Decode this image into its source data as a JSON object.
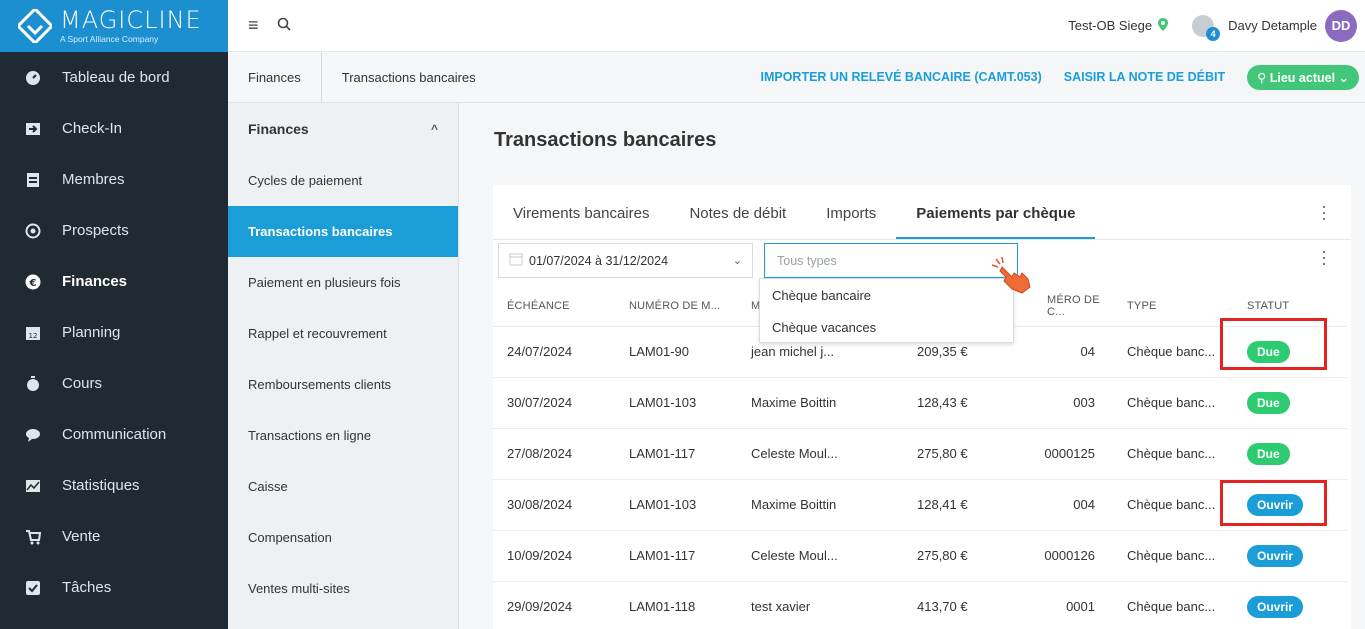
{
  "brand": {
    "name": "MAGICLINE",
    "sub": "A Sport Alliance Company"
  },
  "sidebar": {
    "items": [
      {
        "label": "Tableau de bord",
        "icon": "dashboard-icon"
      },
      {
        "label": "Check-In",
        "icon": "check-in-icon"
      },
      {
        "label": "Membres",
        "icon": "members-icon"
      },
      {
        "label": "Prospects",
        "icon": "prospects-icon"
      },
      {
        "label": "Finances",
        "icon": "euro-icon"
      },
      {
        "label": "Planning",
        "icon": "calendar-icon"
      },
      {
        "label": "Cours",
        "icon": "stopwatch-icon"
      },
      {
        "label": "Communication",
        "icon": "chat-icon"
      },
      {
        "label": "Statistiques",
        "icon": "chart-icon"
      },
      {
        "label": "Vente",
        "icon": "cart-icon"
      },
      {
        "label": "Tâches",
        "icon": "checkbox-icon"
      }
    ]
  },
  "topbar": {
    "location": "Test-OB Siege",
    "downloads": "4",
    "user": "Davy Detample",
    "initials": "DD"
  },
  "breadcrumb": {
    "first": "Finances",
    "current": "Transactions bancaires"
  },
  "actions": {
    "import": "IMPORTER UN RELEVÉ BANCAIRE (CAMT.053)",
    "debit": "SAISIR LA NOTE DE DÉBIT",
    "lieu": "Lieu actuel"
  },
  "submenu": {
    "title": "Finances",
    "items": [
      "Cycles de paiement",
      "Transactions bancaires",
      "Paiement en plusieurs fois",
      "Rappel et recouvrement",
      "Remboursements clients",
      "Transactions en ligne",
      "Caisse",
      "Compensation",
      "Ventes multi-sites"
    ]
  },
  "page": {
    "title": "Transactions bancaires"
  },
  "tabs": [
    "Virements bancaires",
    "Notes de débit",
    "Imports",
    "Paiements par chèque"
  ],
  "filters": {
    "date_range": "01/07/2024 à 31/12/2024",
    "type_placeholder": "Tous types"
  },
  "dropdown": {
    "options": [
      "Chèque bancaire",
      "Chèque vacances"
    ]
  },
  "table": {
    "headers": [
      "ÉCHÉANCE",
      "NUMÉRO DE M...",
      "M",
      "",
      "MÉRO DE C...",
      "TYPE",
      "STATUT"
    ],
    "rows": [
      {
        "date": "24/07/2024",
        "num": "LAM01-90",
        "member": "jean michel j...",
        "amount": "209,35 €",
        "cheque": "04",
        "type": "Chèque banc...",
        "status": "Due"
      },
      {
        "date": "30/07/2024",
        "num": "LAM01-103",
        "member": "Maxime Boittin",
        "amount": "128,43 €",
        "cheque": "003",
        "type": "Chèque banc...",
        "status": "Due"
      },
      {
        "date": "27/08/2024",
        "num": "LAM01-117",
        "member": "Celeste Moul...",
        "amount": "275,80 €",
        "cheque": "0000125",
        "type": "Chèque banc...",
        "status": "Due"
      },
      {
        "date": "30/08/2024",
        "num": "LAM01-103",
        "member": "Maxime Boittin",
        "amount": "128,41 €",
        "cheque": "004",
        "type": "Chèque banc...",
        "status": "Ouvrir"
      },
      {
        "date": "10/09/2024",
        "num": "LAM01-117",
        "member": "Celeste Moul...",
        "amount": "275,80 €",
        "cheque": "0000126",
        "type": "Chèque banc...",
        "status": "Ouvrir"
      },
      {
        "date": "29/09/2024",
        "num": "LAM01-118",
        "member": "test xavier",
        "amount": "413,70 €",
        "cheque": "0001",
        "type": "Chèque banc...",
        "status": "Ouvrir"
      }
    ]
  },
  "colors": {
    "brand": "#1b8fd0",
    "accent": "#1b9ed8",
    "due": "#2ecc71",
    "open": "#1b9ed8",
    "highlight": "#e32222"
  }
}
